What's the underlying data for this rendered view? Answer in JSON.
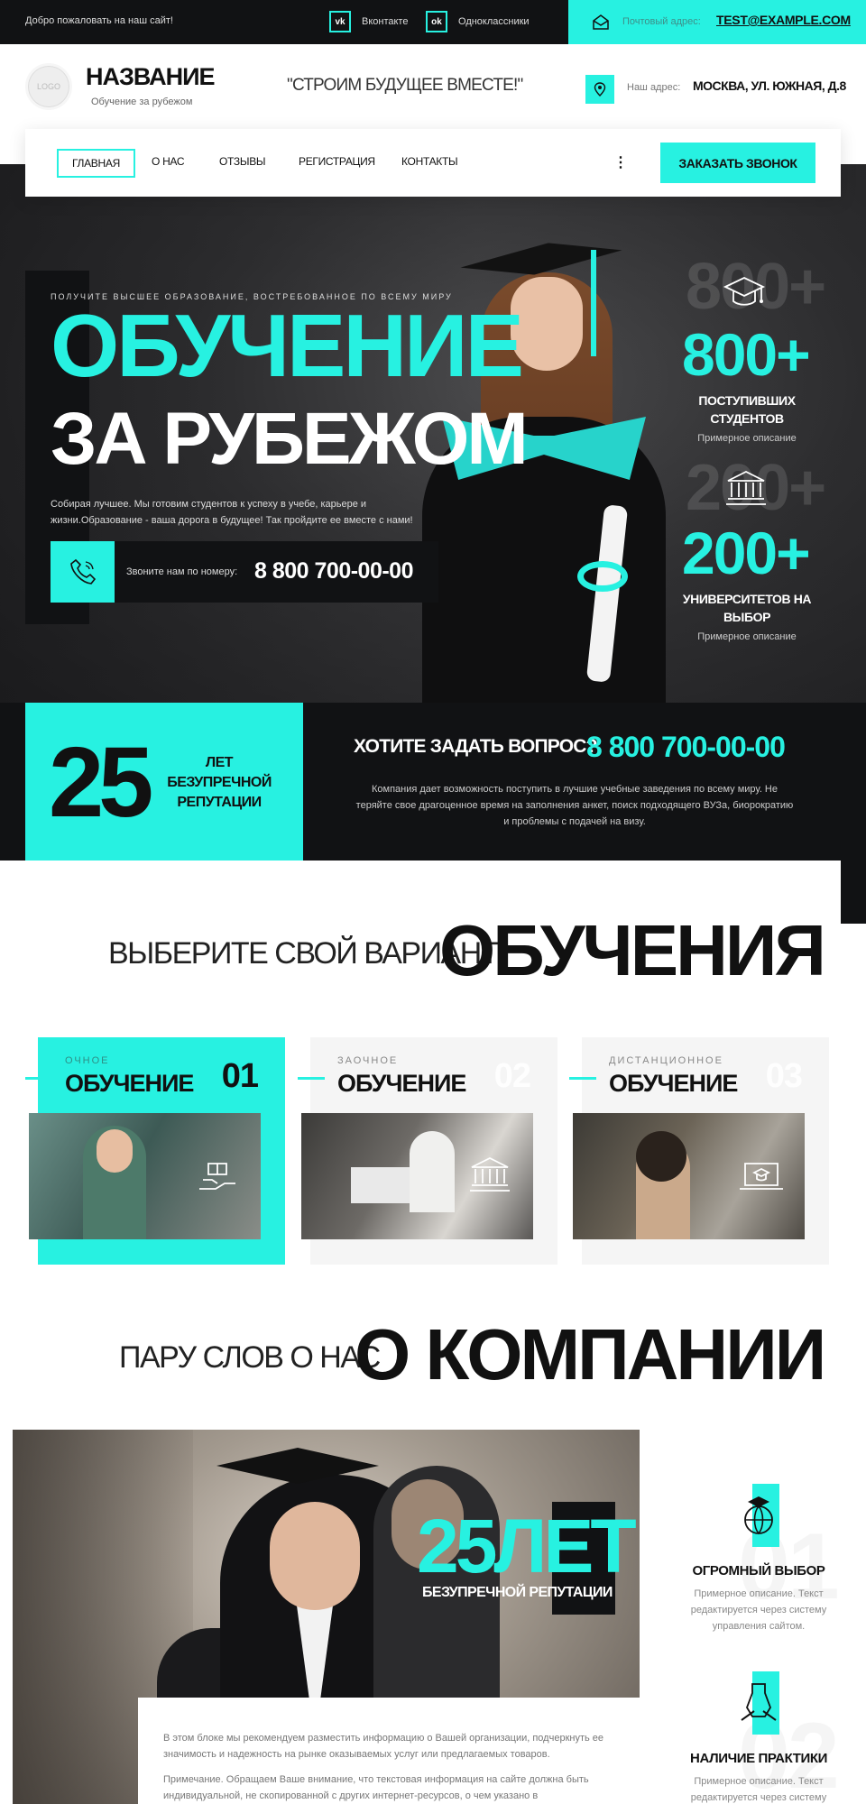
{
  "topbar": {
    "welcome": "Добро пожаловать на наш сайт!",
    "socials": [
      {
        "icon": "vk-icon",
        "glyph": "vk",
        "label": "Вконтакте"
      },
      {
        "icon": "odnoklassniki-icon",
        "glyph": "ok",
        "label": "Одноклассники"
      }
    ],
    "mail_label": "Почтовый адрес:",
    "mail_value": "TEST@EXAMPLE.COM"
  },
  "header": {
    "logo": "LOGO",
    "brand": "НАЗВАНИЕ",
    "brand_sub": "Обучение за рубежом",
    "slogan": "\"СТРОИМ БУДУЩЕЕ ВМЕСТЕ!\"",
    "address_label": "Наш адрес:",
    "address_value": "МОСКВА, УЛ. ЮЖНАЯ, Д.8"
  },
  "nav": {
    "items": [
      "ГЛАВНАЯ",
      "О НАС",
      "ОТЗЫВЫ",
      "РЕГИСТРАЦИЯ",
      "КОНТАКТЫ"
    ],
    "more": "⋮",
    "call_button": "ЗАКАЗАТЬ ЗВОНОК"
  },
  "hero": {
    "kicker": "ПОЛУЧИТЕ ВЫСШЕЕ ОБРАЗОВАНИЕ, ВОСТРЕБОВАННОЕ ПО ВСЕМУ МИРУ",
    "title_line1": "ОБУЧЕНИЕ",
    "title_line2": "ЗА РУБЕЖОМ",
    "description": "Собирая лучшее. Мы готовим студентов к успеху в учебе, карьере и жизни.Образование - ваша дорога в будущее! Так пройдите ее вместе с нами!",
    "phone_label": "Звоните нам по номеру:",
    "phone_number": "8 800 700-00-00",
    "stats": [
      {
        "icon": "graduation-cap-icon",
        "ghost": "800+",
        "value": "800+",
        "label": "ПОСТУПИВШИХ СТУДЕНТОВ",
        "desc": "Примерное описание"
      },
      {
        "icon": "university-icon",
        "ghost": "200+",
        "value": "200+",
        "label": "УНИВЕРСИТЕТОВ НА ВЫБОР",
        "desc": "Примерное описание"
      }
    ]
  },
  "reputation": {
    "number": "25",
    "text": "ЛЕТ БЕЗУПРЕЧНОЙ РЕПУТАЦИИ",
    "question": "ХОТИТЕ ЗАДАТЬ ВОПРОС?",
    "phone": "8 800 700-00-00",
    "description": "Компания дает возможность поступить в лучшие учебные заведения по всему миру. Не теряйте свое драгоценное время на заполнения анкет, поиск подходящего ВУЗа, биорократию и проблемы с подачей на визу."
  },
  "study": {
    "subtitle": "ВЫБЕРИТЕ СВОЙ ВАРИАНТ",
    "title": "ОБУЧЕНИЯ",
    "cards": [
      {
        "kind": "ОЧНОЕ",
        "title": "ОБУЧЕНИЕ",
        "num": "01",
        "icon": "hand-book-icon"
      },
      {
        "kind": "ЗАОЧНОЕ",
        "title": "ОБУЧЕНИЕ",
        "num": "02",
        "icon": "university-icon"
      },
      {
        "kind": "ДИСТАНЦИОННОЕ",
        "title": "ОБУЧЕНИЕ",
        "num": "03",
        "icon": "laptop-cap-icon"
      }
    ]
  },
  "about": {
    "subtitle": "ПАРУ СЛОВ О НАС",
    "title": "О КОМПАНИИ",
    "years": "25ЛЕТ",
    "years_label": "БЕЗУПРЕЧНОЙ РЕПУТАЦИИ",
    "text1": "В этом блоке мы рекомендуем разместить информацию о Вашей организации, подчеркнуть ее значимость и надежность на рынке оказываемых услуг или предлагаемых товаров.",
    "text2": "Примечание. Обращаем Ваше внимание, что текстовая информация на сайте должна быть индивидуальной, не скопированной с других интернет-ресурсов, о чем указано в",
    "features": [
      {
        "icon": "globe-cap-icon",
        "ghost": "01",
        "title": "ОГРОМНЫЙ ВЫБОР",
        "desc": "Примерное описание. Текст редактируется через систему управления сайтом."
      },
      {
        "icon": "practice-icon",
        "ghost": "02",
        "title": "НАЛИЧИЕ ПРАКТИКИ",
        "desc": "Примерное описание. Текст редактируется через систему"
      }
    ]
  },
  "colors": {
    "accent": "#27f1e1",
    "dark": "#111214"
  }
}
